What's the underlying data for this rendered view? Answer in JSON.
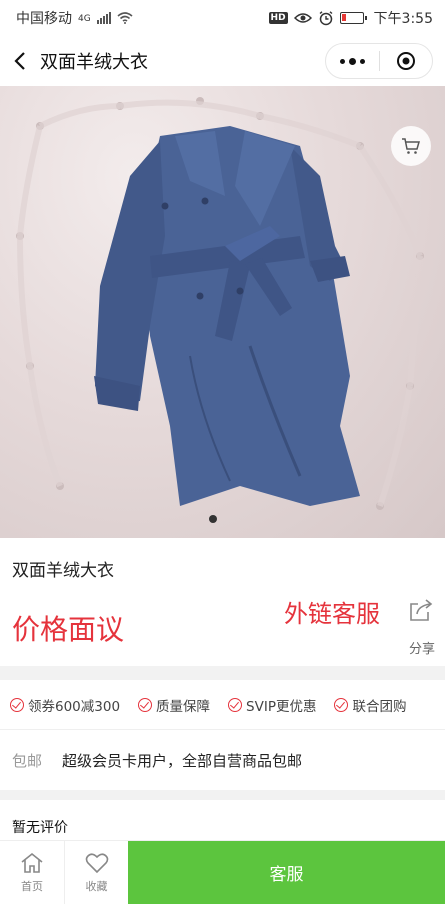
{
  "status_bar": {
    "carrier": "中国移动",
    "network": "4G",
    "time": "下午3:55",
    "hd": "HD"
  },
  "nav": {
    "title": "双面羊绒大衣"
  },
  "product": {
    "name": "双面羊绒大衣",
    "price_text": "价格面议",
    "external_link": "外链客服",
    "share_label": "分享"
  },
  "promotions": [
    "领券600减300",
    "质量保障",
    "SVIP更优惠",
    "联合团购"
  ],
  "shipping": {
    "label": "包邮",
    "text": "超级会员卡用户，全部自营商品包邮"
  },
  "reviews": {
    "title": "暂无评价"
  },
  "tabbar": {
    "home_label": "首页",
    "favorite_label": "收藏",
    "service_label": "客服"
  },
  "colors": {
    "accent_red": "#e5333c",
    "service_green": "#5cc53e",
    "coat_blue": "#4a6396"
  }
}
